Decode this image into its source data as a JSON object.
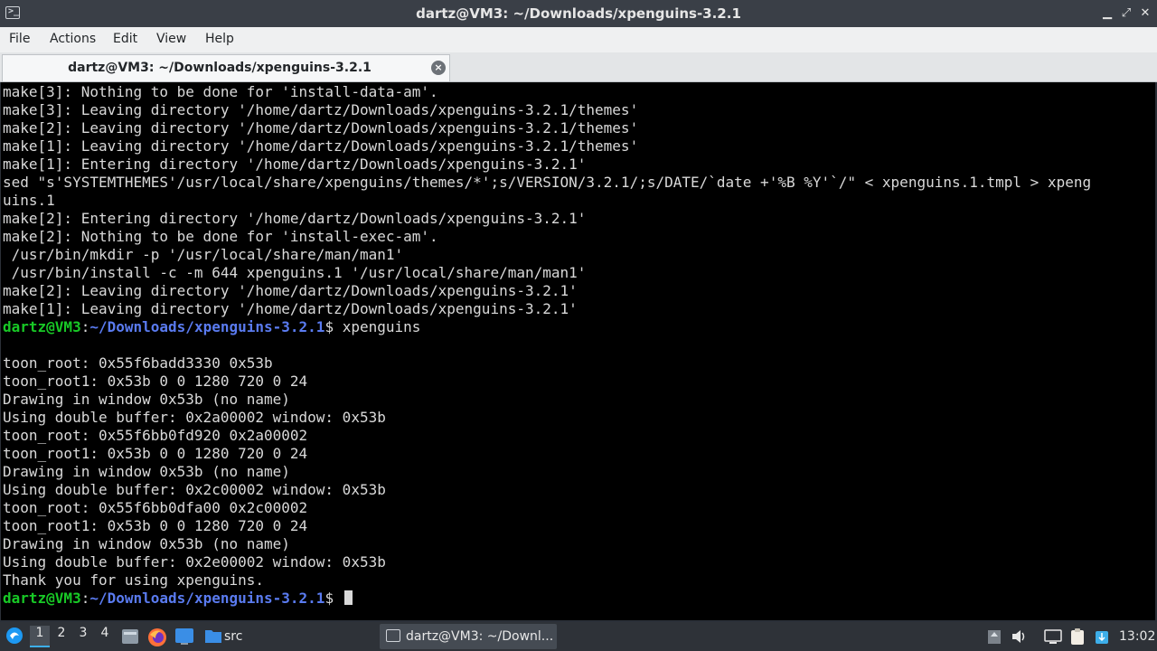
{
  "window": {
    "title": "dartz@VM3: ~/Downloads/xpenguins-3.2.1",
    "app_icon_glyph": ">_",
    "minimize_glyph": "▁",
    "maximize_glyph": "⤢",
    "close_glyph": "✕"
  },
  "menu": [
    "File",
    "Actions",
    "Edit",
    "View",
    "Help"
  ],
  "tab": {
    "label": "dartz@VM3: ~/Downloads/xpenguins-3.2.1",
    "close_glyph": "×"
  },
  "terminal": {
    "prompt_user": "dartz@VM3",
    "prompt_colon": ":",
    "prompt_path": "~/Downloads/xpenguins-3.2.1",
    "prompt_symbol": "$ ",
    "block1": [
      "make[3]: Nothing to be done for 'install-data-am'.",
      "make[3]: Leaving directory '/home/dartz/Downloads/xpenguins-3.2.1/themes'",
      "make[2]: Leaving directory '/home/dartz/Downloads/xpenguins-3.2.1/themes'",
      "make[1]: Leaving directory '/home/dartz/Downloads/xpenguins-3.2.1/themes'",
      "make[1]: Entering directory '/home/dartz/Downloads/xpenguins-3.2.1'",
      "sed \"s'SYSTEMTHEMES'/usr/local/share/xpenguins/themes/*';s/VERSION/3.2.1/;s/DATE/`date +'%B %Y'`/\" < xpenguins.1.tmpl > xpeng",
      "uins.1",
      "make[2]: Entering directory '/home/dartz/Downloads/xpenguins-3.2.1'",
      "make[2]: Nothing to be done for 'install-exec-am'.",
      " /usr/bin/mkdir -p '/usr/local/share/man/man1'",
      " /usr/bin/install -c -m 644 xpenguins.1 '/usr/local/share/man/man1'",
      "make[2]: Leaving directory '/home/dartz/Downloads/xpenguins-3.2.1'",
      "make[1]: Leaving directory '/home/dartz/Downloads/xpenguins-3.2.1'"
    ],
    "command1": "xpenguins",
    "block2": [
      "",
      "toon_root: 0x55f6badd3330 0x53b",
      "toon_root1: 0x53b 0 0 1280 720 0 24",
      "Drawing in window 0x53b (no name)",
      "Using double buffer: 0x2a00002 window: 0x53b",
      "toon_root: 0x55f6bb0fd920 0x2a00002",
      "toon_root1: 0x53b 0 0 1280 720 0 24",
      "Drawing in window 0x53b (no name)",
      "Using double buffer: 0x2c00002 window: 0x53b",
      "toon_root: 0x55f6bb0dfa00 0x2c00002",
      "toon_root1: 0x53b 0 0 1280 720 0 24",
      "Drawing in window 0x53b (no name)",
      "Using double buffer: 0x2e00002 window: 0x53b",
      "Thank you for using xpenguins."
    ]
  },
  "taskbar": {
    "workspaces": [
      "1",
      "2",
      "3",
      "4"
    ],
    "launchers": [
      "file-manager-icon",
      "firefox-icon",
      "desktop-icon"
    ],
    "folder_label": "src",
    "task_label": "dartz@VM3: ~/Downl...",
    "clock": "13:02",
    "tray": [
      "drive-icon",
      "volume-icon",
      "display-icon",
      "clipboard-icon",
      "updates-icon"
    ],
    "accent": "#3daee9"
  }
}
